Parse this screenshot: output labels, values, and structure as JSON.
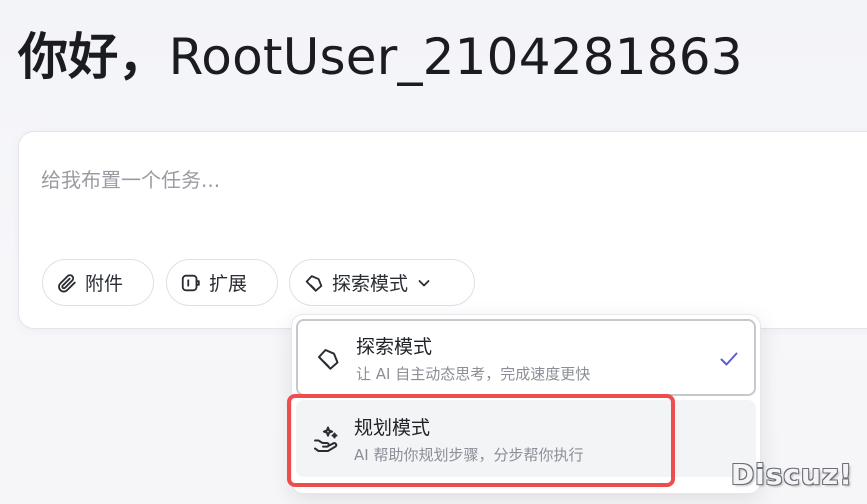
{
  "greeting": {
    "hello": "你好，",
    "username": "RootUser_2104281863"
  },
  "composer": {
    "placeholder": "给我布置一个任务...",
    "value": ""
  },
  "toolbar": {
    "attach_label": "附件",
    "extend_label": "扩展",
    "mode_label": "探索模式"
  },
  "icons": {
    "attach": "paperclip-icon",
    "extend": "plugin-icon",
    "explore": "tag-icon",
    "plan": "sparkle-hand-icon",
    "selected": "check-icon",
    "expand": "chevron-down-icon"
  },
  "mode_menu": {
    "options": [
      {
        "title": "探索模式",
        "description": "让 AI 自主动态思考，完成速度更快",
        "selected": true
      },
      {
        "title": "规划模式",
        "description": "AI 帮助你规划步骤，分步帮你执行",
        "selected": false
      }
    ]
  },
  "colors": {
    "check": "#5b5bd6",
    "highlight": "#ee4d4d"
  },
  "watermark": {
    "text": "Discuz!"
  }
}
